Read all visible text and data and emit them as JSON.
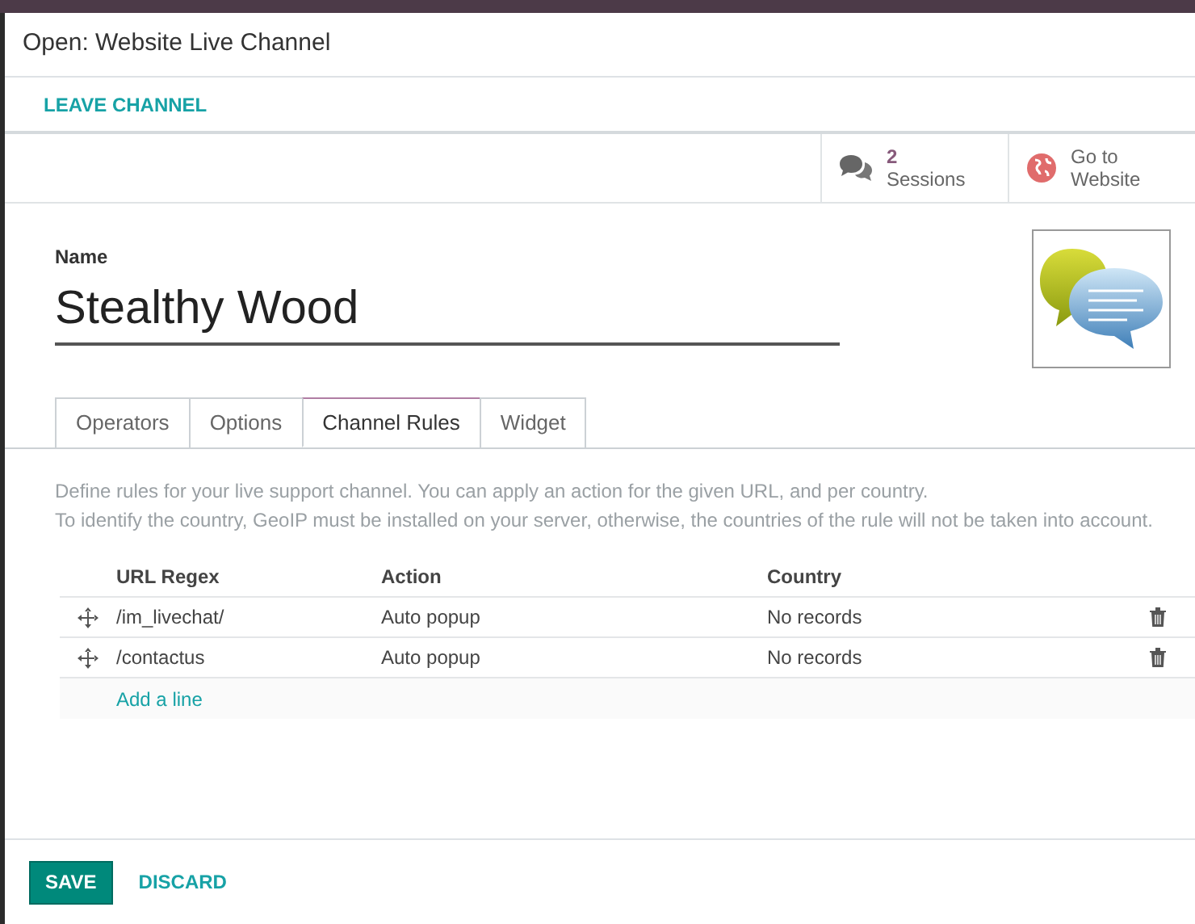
{
  "window": {
    "title": "Open: Website Live Channel"
  },
  "header_buttons": [
    {
      "label": "LEAVE CHANNEL"
    }
  ],
  "smart_buttons": [
    {
      "kind": "stat",
      "value": "2",
      "label": "Sessions"
    },
    {
      "kind": "link",
      "value": "Go to",
      "label": "Website"
    }
  ],
  "form": {
    "name_label": "Name",
    "name": "Stealthy Wood"
  },
  "tabs": [
    {
      "label": "Operators",
      "selected": false
    },
    {
      "label": "Options",
      "selected": false
    },
    {
      "label": "Channel Rules",
      "selected": true
    },
    {
      "label": "Widget",
      "selected": false
    }
  ],
  "help_text": [
    "Define rules for your live support channel. You can apply an action for the given URL, and per country.",
    "To identify the country, GeoIP must be installed on your server, otherwise, the countries of the rule will not be taken into account."
  ],
  "table": {
    "columns": [
      "URL Regex",
      "Action",
      "Country"
    ],
    "rows": [
      {
        "url": "/im_livechat/",
        "action": "Auto popup",
        "country": "No records"
      },
      {
        "url": "/contactus",
        "action": "Auto popup",
        "country": "No records"
      }
    ],
    "add_line": "Add a line"
  },
  "footer_buttons": [
    {
      "label": "SAVE",
      "kind": "primary"
    },
    {
      "label": "DISCARD",
      "kind": "link"
    }
  ]
}
